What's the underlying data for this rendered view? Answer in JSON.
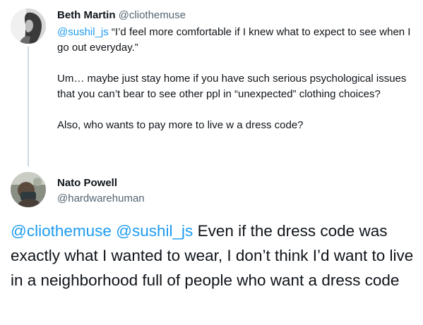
{
  "tweet1": {
    "display_name": "Beth Martin",
    "handle": "@cliothemuse",
    "mention": "@sushil_js",
    "quote_text": " “I’d feel more comfortable if I knew what to expect to see when I go out everyday.”",
    "paragraph2": "Um… maybe just stay home if you have such serious psychological issues that you can’t bear to see other ppl in “unexpected” clothing choices?",
    "paragraph3": "Also, who wants to pay more to live w a dress code?"
  },
  "tweet2": {
    "display_name": "Nato Powell",
    "handle": "@hardwarehuman",
    "mention1": "@cliothemuse",
    "mention2": "@sushil_js",
    "text": " Even if the dress code was exactly what I wanted to wear, I don’t think I’d want to live in a neighborhood full of people who want a dress code"
  },
  "colors": {
    "text": "#0f1419",
    "secondary": "#536471",
    "link": "#1d9bf0",
    "thread_line": "#cfd9de"
  },
  "icons": {
    "beth_avatar": "avatar-photo",
    "nato_avatar": "avatar-photo"
  }
}
